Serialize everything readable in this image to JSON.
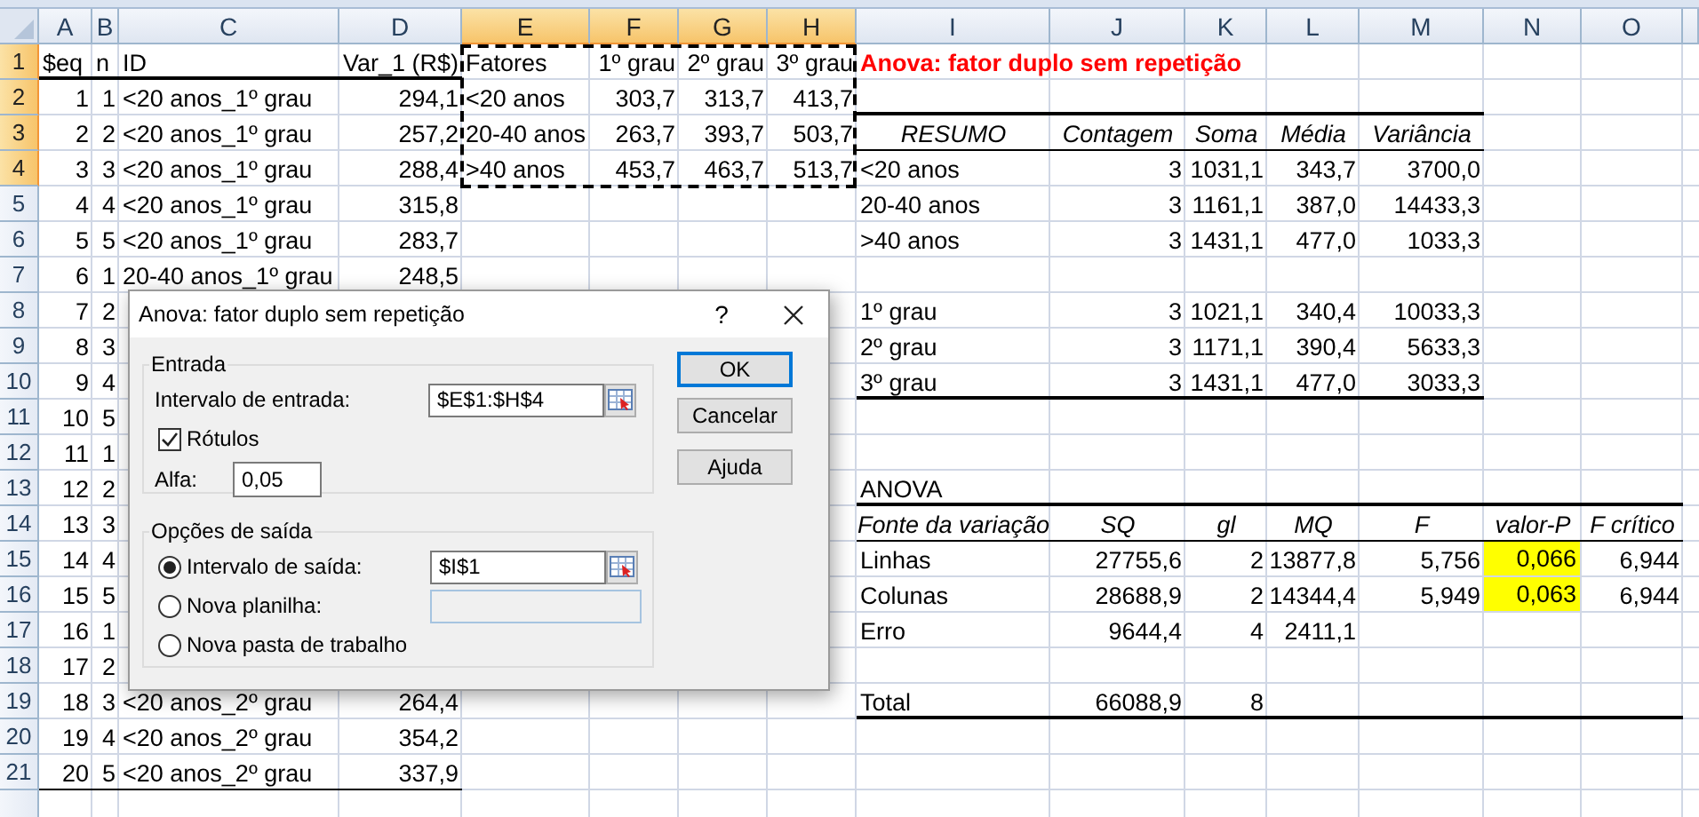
{
  "column_headers": [
    {
      "label": "A",
      "selected": false
    },
    {
      "label": "B",
      "selected": false
    },
    {
      "label": "C",
      "selected": false
    },
    {
      "label": "D",
      "selected": false
    },
    {
      "label": "E",
      "selected": true
    },
    {
      "label": "F",
      "selected": true
    },
    {
      "label": "G",
      "selected": true
    },
    {
      "label": "H",
      "selected": true
    },
    {
      "label": "I",
      "selected": false
    },
    {
      "label": "J",
      "selected": false
    },
    {
      "label": "K",
      "selected": false
    },
    {
      "label": "L",
      "selected": false
    },
    {
      "label": "M",
      "selected": false
    },
    {
      "label": "N",
      "selected": false
    },
    {
      "label": "O",
      "selected": false
    }
  ],
  "row_headers": [
    {
      "label": "1",
      "selected": true
    },
    {
      "label": "2",
      "selected": true
    },
    {
      "label": "3",
      "selected": true
    },
    {
      "label": "4",
      "selected": true
    },
    {
      "label": "5",
      "selected": false
    },
    {
      "label": "6",
      "selected": false
    },
    {
      "label": "7",
      "selected": false
    },
    {
      "label": "8",
      "selected": false
    },
    {
      "label": "9",
      "selected": false
    },
    {
      "label": "10",
      "selected": false
    },
    {
      "label": "11",
      "selected": false
    },
    {
      "label": "12",
      "selected": false
    },
    {
      "label": "13",
      "selected": false
    },
    {
      "label": "14",
      "selected": false
    },
    {
      "label": "15",
      "selected": false
    },
    {
      "label": "16",
      "selected": false
    },
    {
      "label": "17",
      "selected": false
    },
    {
      "label": "18",
      "selected": false
    },
    {
      "label": "19",
      "selected": false
    },
    {
      "label": "20",
      "selected": false
    },
    {
      "label": "21",
      "selected": false
    }
  ],
  "data_table": {
    "header": [
      "$eq",
      "n",
      "ID",
      "Var_1 (R$)"
    ],
    "rows": [
      [
        "1",
        "1",
        "<20 anos_1º grau",
        "294,1"
      ],
      [
        "2",
        "2",
        "<20 anos_1º grau",
        "257,2"
      ],
      [
        "3",
        "3",
        "<20 anos_1º grau",
        "288,4"
      ],
      [
        "4",
        "4",
        "<20 anos_1º grau",
        "315,8"
      ],
      [
        "5",
        "5",
        "<20 anos_1º grau",
        "283,7"
      ],
      [
        "6",
        "1",
        "20-40 anos_1º grau",
        "248,5"
      ],
      [
        "7",
        "2"
      ],
      [
        "8",
        "3"
      ],
      [
        "9",
        "4"
      ],
      [
        "10",
        "5"
      ],
      [
        "11",
        "1"
      ],
      [
        "12",
        "2"
      ],
      [
        "13",
        "3"
      ],
      [
        "14",
        "4"
      ],
      [
        "15",
        "5"
      ],
      [
        "16",
        "1"
      ],
      [
        "17",
        "2"
      ],
      [
        "18",
        "3",
        "<20 anos_2º grau",
        "264,4"
      ],
      [
        "19",
        "4",
        "<20 anos_2º grau",
        "354,2"
      ],
      [
        "20",
        "5",
        "<20 anos_2º grau",
        "337,9"
      ]
    ]
  },
  "factors_table": {
    "header": [
      "Fatores",
      "1º grau",
      "2º grau",
      "3º grau"
    ],
    "rows": [
      [
        "<20 anos",
        "303,7",
        "313,7",
        "413,7"
      ],
      [
        "20-40 anos",
        "263,7",
        "393,7",
        "503,7"
      ],
      [
        ">40 anos",
        "453,7",
        "463,7",
        "513,7"
      ]
    ]
  },
  "output_title": "Anova: fator duplo sem repetição",
  "summary_table": {
    "header": [
      "RESUMO",
      "Contagem",
      "Soma",
      "Média",
      "Variância"
    ],
    "row_groups": [
      [
        [
          "<20 anos",
          "3",
          "1031,1",
          "343,7",
          "3700,0"
        ],
        [
          "20-40 anos",
          "3",
          "1161,1",
          "387,0",
          "14433,3"
        ],
        [
          ">40 anos",
          "3",
          "1431,1",
          "477,0",
          "1033,3"
        ]
      ],
      [
        [
          "1º grau",
          "3",
          "1021,1",
          "340,4",
          "10033,3"
        ],
        [
          "2º grau",
          "3",
          "1171,1",
          "390,4",
          "5633,3"
        ],
        [
          "3º grau",
          "3",
          "1431,1",
          "477,0",
          "3033,3"
        ]
      ]
    ]
  },
  "anova_table": {
    "label": "ANOVA",
    "header": [
      "Fonte da variação",
      "SQ",
      "gl",
      "MQ",
      "F",
      "valor-P",
      "F crítico"
    ],
    "rows": [
      [
        "Linhas",
        "27755,6",
        "2",
        "13877,8",
        "5,756",
        "0,066",
        "6,944"
      ],
      [
        "Colunas",
        "28688,9",
        "2",
        "14344,4",
        "5,949",
        "0,063",
        "6,944"
      ],
      [
        "Erro",
        "9644,4",
        "4",
        "2411,1"
      ]
    ],
    "total": [
      "Total",
      "66088,9",
      "8"
    ]
  },
  "dialog": {
    "title": "Anova: fator duplo sem repetição",
    "help": "?",
    "input_group": {
      "legend": "Entrada",
      "range_label": "Intervalo de entrada:",
      "range_value": "$E$1:$H$4",
      "labels_checkbox": {
        "label": "Rótulos",
        "checked": true
      },
      "alpha_label": "Alfa:",
      "alpha_value": "0,05"
    },
    "output_group": {
      "legend": "Opções de saída",
      "options": [
        {
          "label": "Intervalo de saída:",
          "selected": true,
          "field": {
            "value": "$I$1",
            "disabled": false
          }
        },
        {
          "label": "Nova planilha:",
          "selected": false,
          "field": {
            "disabled": true
          }
        },
        {
          "label": "Nova pasta de trabalho",
          "selected": false
        }
      ]
    },
    "buttons": [
      {
        "label": "OK",
        "default": true
      },
      {
        "label": "Cancelar",
        "default": false
      },
      {
        "label": "Ajuda",
        "default": false
      }
    ]
  }
}
